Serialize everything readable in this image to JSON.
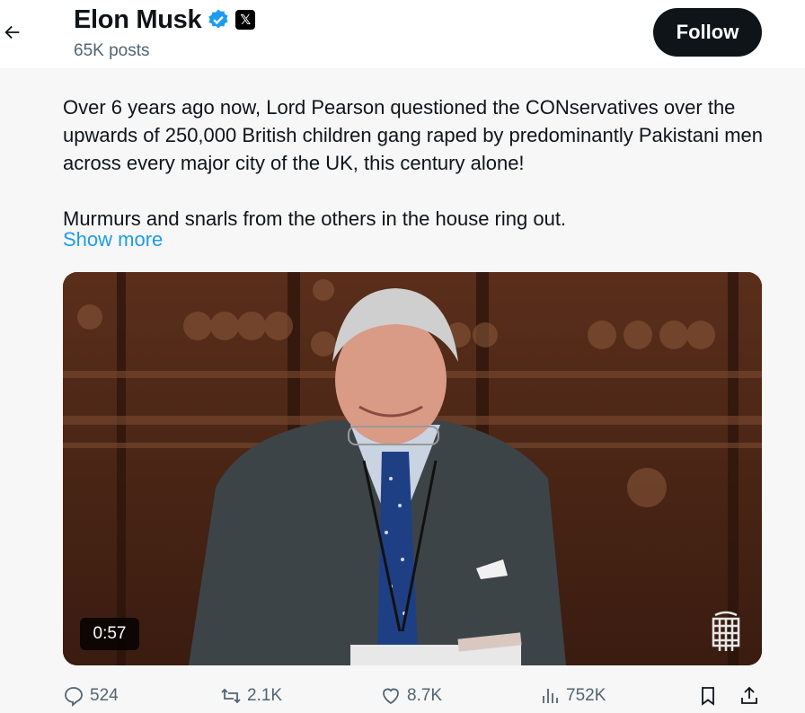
{
  "header": {
    "author_name": "Elon Musk",
    "post_count": "65K posts",
    "follow_label": "Follow",
    "x_badge": "𝕏",
    "back_icon": "arrow-left-icon",
    "verified_icon": "verified-badge-icon"
  },
  "tweet": {
    "text": "Over 6 years ago now, Lord Pearson questioned the CONservatives over the upwards of 250,000 British children gang raped by predominantly Pakistani men across every major city of the UK, this century alone!\n\nMurmurs and snarls from the others in the house ring out.",
    "show_more": "Show more"
  },
  "video": {
    "duration": "0:57",
    "watermark_icon": "portcullis-icon"
  },
  "actions": {
    "replies": "524",
    "reposts": "2.1K",
    "likes": "8.7K",
    "views": "752K"
  },
  "colors": {
    "accent": "#1d9bf0",
    "text": "#0f1419",
    "muted": "#536471",
    "background": "#f7f7f7"
  }
}
